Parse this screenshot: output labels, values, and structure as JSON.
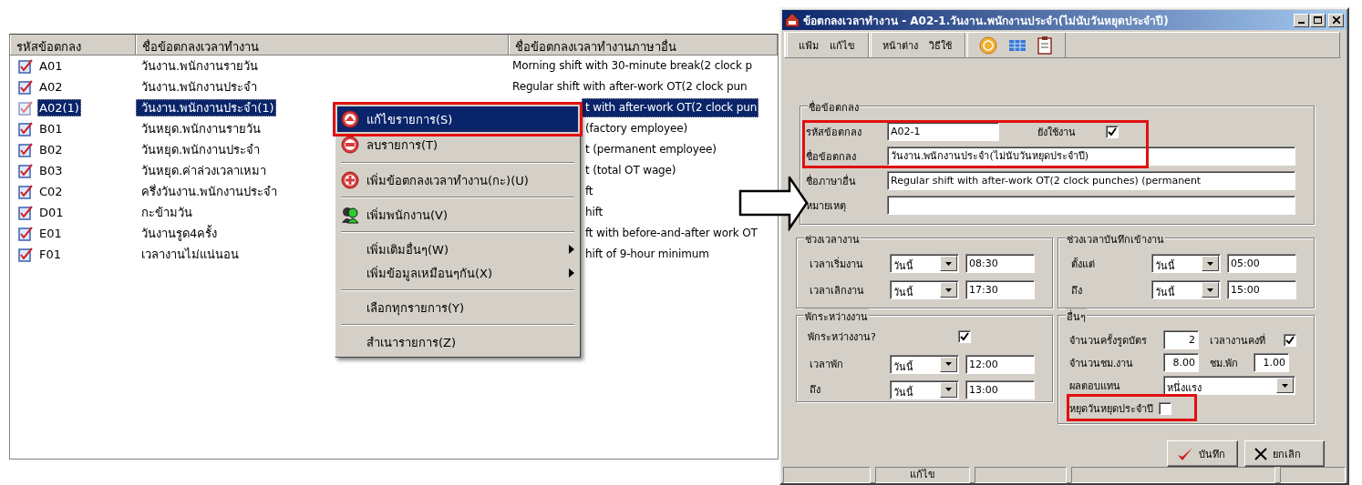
{
  "list": {
    "columns": [
      "รหัสข้อตกลง",
      "ชื่อข้อตกลงเวลาทำงาน",
      "ชื่อข้อตกลงเวลาทำงานภาษาอื่น"
    ],
    "rows": [
      {
        "code": "A01",
        "name": "วันงาน.พนักงานรายวัน",
        "other_name": "Morning shift with 30-minute break(2 clock p",
        "selected": false
      },
      {
        "code": "A02",
        "name": "วันงาน.พนักงานประจำ",
        "other_name": "Regular shift with after-work OT(2 clock pun",
        "selected": false
      },
      {
        "code": "A02(1)",
        "name": "วันงาน.พนักงานประจำ(1)",
        "other_name": "t with after-work OT(2 clock pun",
        "selected": true
      },
      {
        "code": "B01",
        "name": "วันหยุด.พนักงานรายวัน",
        "other_name": "(factory employee)",
        "selected": false
      },
      {
        "code": "B02",
        "name": "วันหยุด.พนักงานประจำ",
        "other_name": "t (permanent employee)",
        "selected": false
      },
      {
        "code": "B03",
        "name": "วันหยุด.ค่าล่วงเวลาเหมา",
        "other_name": "t (total OT wage)",
        "selected": false
      },
      {
        "code": "C02",
        "name": "ครึ่งวันงาน.พนักงานประจำ",
        "other_name": "ft",
        "selected": false
      },
      {
        "code": "D01",
        "name": "กะข้ามวัน",
        "other_name": "hift",
        "selected": false
      },
      {
        "code": "E01",
        "name": "วันงานรูด4ครั้ง",
        "other_name": "ft with before-and-after work OT",
        "selected": false
      },
      {
        "code": "F01",
        "name": "เวลางานไม่แน่นอน",
        "other_name": "hift of 9-hour minimum",
        "selected": false
      }
    ]
  },
  "context_menu": {
    "items": [
      {
        "kind": "action",
        "label": "แก้ไขรายการ(S)",
        "selected": true
      },
      {
        "kind": "action",
        "label": "ลบรายการ(T)",
        "selected": false
      },
      {
        "kind": "separator"
      },
      {
        "kind": "action",
        "label": "เพิ่มข้อตกลงเวลาทำงาน(กะ)(U)",
        "selected": false
      },
      {
        "kind": "separator"
      },
      {
        "kind": "action",
        "label": "เพิ่มพนักงาน(V)",
        "selected": false
      },
      {
        "kind": "separator"
      },
      {
        "kind": "submenu",
        "label": "เพิ่มเติมอื่นๆ(W)",
        "selected": false
      },
      {
        "kind": "submenu",
        "label": "เพิ่มข้อมูลเหมือนๆกัน(X)",
        "selected": false
      },
      {
        "kind": "separator"
      },
      {
        "kind": "action",
        "label": "เลือกทุกรายการ(Y)",
        "selected": false
      },
      {
        "kind": "separator"
      },
      {
        "kind": "action",
        "label": "สำเนารายการ(Z)",
        "selected": false
      }
    ]
  },
  "dialog": {
    "title": "ข้อตกลงเวลาทำงาน - A02-1.วันงาน.พนักงานประจำ(ไม่นับวันหยุดประจำปี)",
    "menu_groups": [
      [
        "แฟ้ม",
        "แก้ไข"
      ],
      [
        "หน้าต่าง",
        "วิธีใช้"
      ]
    ],
    "agreement": {
      "legend": "ชื่อข้อตกลง",
      "code_label": "รหัสข้อตกลง",
      "code": "A02-1",
      "active_label": "ยังใช้งาน",
      "active": true,
      "name_label": "ชื่อข้อตกลง",
      "name": "วันงาน.พนักงานประจำ(ไม่นับวันหยุดประจำปี)",
      "other_label": "ชื่อภาษาอื่น",
      "other_name": "Regular shift with after-work OT(2 clock punches) (permanent",
      "note_label": "หมายเหตุ"
    },
    "work_time": {
      "legend": "ช่วงเวลางาน",
      "rows": [
        {
          "label": "เวลาเริ่มงาน",
          "day": "วันนี้",
          "time": "08:30"
        },
        {
          "label": "เวลาเลิกงาน",
          "day": "วันนี้",
          "time": "17:30"
        }
      ]
    },
    "clock_window": {
      "legend": "ช่วงเวลาบันทึกเข้างาน",
      "rows": [
        {
          "label": "ตั้งแต่",
          "day": "วันนี้",
          "time": "05:00"
        },
        {
          "label": "ถึง",
          "day": "วันนี้",
          "time": "15:00"
        }
      ]
    },
    "break": {
      "legend": "พักระหว่างงาน",
      "has_break_label": "พักระหว่างงาน?",
      "has_break": true,
      "rows": [
        {
          "label": "เวลาพัก",
          "day": "วันนี้",
          "time": "12:00"
        },
        {
          "label": "ถึง",
          "day": "วันนี้",
          "time": "13:00"
        }
      ]
    },
    "other": {
      "legend": "อื่นๆ",
      "punches_label": "จำนวนครั้งรูดบัตร",
      "punches": "2",
      "fixed_label": "เวลางานคงที่",
      "fixed": true,
      "hours_label": "จำนวนชม.งาน",
      "hours": "8.00",
      "break_hours_label": "ชม.พัก",
      "break_hours": "1.00",
      "pay_label": "ผลตอบแทน",
      "pay": "หนึ่งแรง",
      "holiday_label": "หยุดวันหยุดประจำปี",
      "holiday": false
    },
    "buttons": [
      {
        "kind": "save",
        "label": "บันทึก"
      },
      {
        "kind": "cancel",
        "label": "ยกเลิก"
      }
    ],
    "status_bar": {
      "text": "แก้ไข"
    }
  }
}
